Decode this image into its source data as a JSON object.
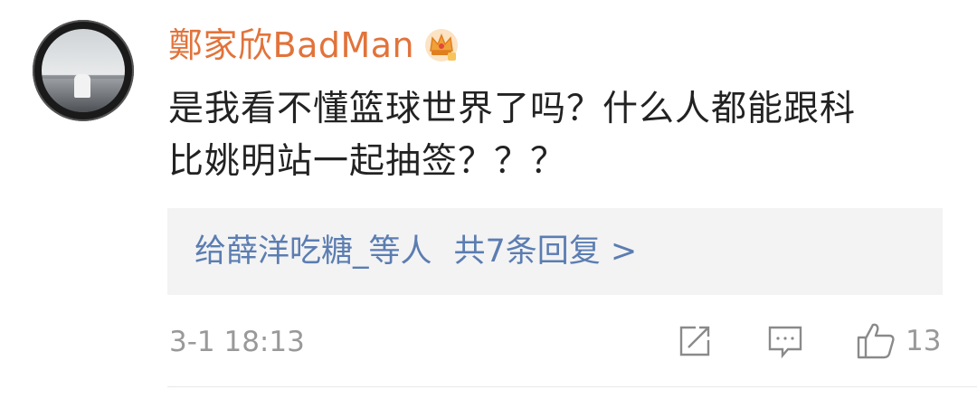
{
  "comment": {
    "username": "鄭家欣BadMan",
    "badge_icon": "crown-vip-icon",
    "text_line1": "是我看不懂篮球世界了吗？什么人都能跟科",
    "text_line2": "比姚明站一起抽签？？？",
    "replies": {
      "from": "给薛洋吃糖_等人",
      "count_label": "共7条回复 >"
    },
    "timestamp": "3-1 18:13",
    "actions": {
      "share_icon": "share-icon",
      "comment_icon": "comment-icon",
      "like_icon": "thumbs-up-icon",
      "like_count": "13"
    }
  },
  "colors": {
    "username": "#e2733a",
    "link": "#5b7db1",
    "muted": "#999999",
    "reply_bg": "#f3f3f4"
  }
}
